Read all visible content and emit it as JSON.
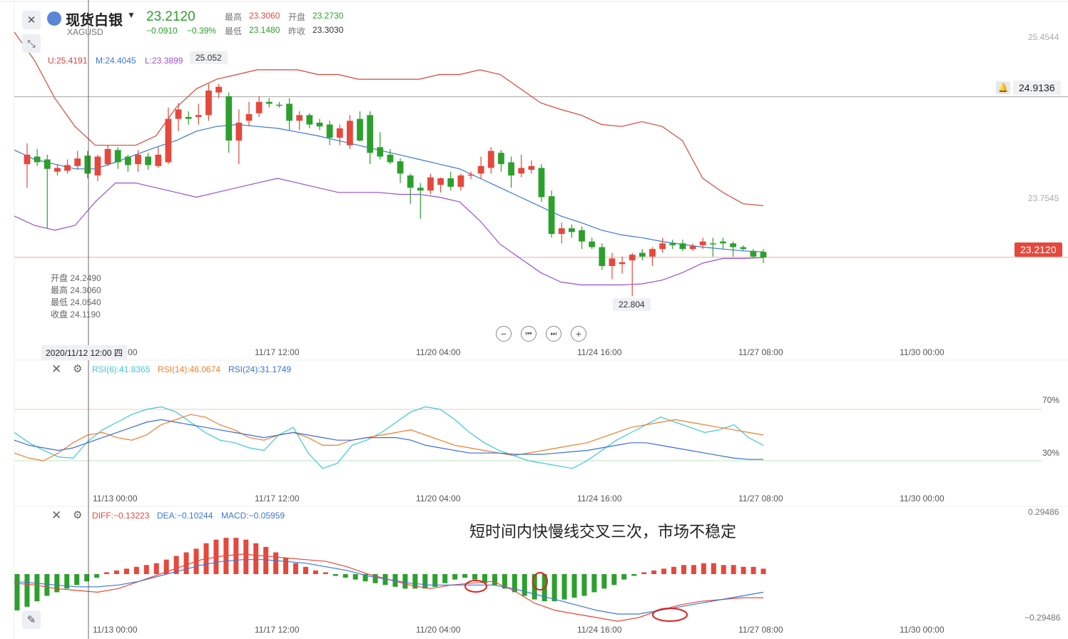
{
  "header": {
    "name": "现货白银",
    "code": "XAGUSD",
    "price": "23.2120",
    "change": "−0.0910",
    "change_pct": "−0.39%",
    "high_label": "最高",
    "high": "23.3060",
    "open_label": "开盘",
    "open": "23.2730",
    "low_label": "最低",
    "low": "23.1480",
    "prev_label": "昨收",
    "prev": "23.3030"
  },
  "boll": {
    "u": "U:25.4191",
    "m": "M:24.4045",
    "l": "L:23.3899"
  },
  "price_axis": {
    "top": "25.4544",
    "mid": "23.7545",
    "line_value": "24.9136",
    "current": "23.2120"
  },
  "callouts": {
    "high": "25.052",
    "low": "22.804"
  },
  "ohlc_tooltip": {
    "open": "开盘 24.2490",
    "high": "最高 24.3060",
    "low": "最低 24.0540",
    "close": "收盘 24.1190"
  },
  "time_axis": {
    "labels": [
      "11/13 00:00",
      "11/17 12:00",
      "11/20 04:00",
      "11/24 16:00",
      "11/27 08:00",
      "11/30 00:00"
    ],
    "crosshair": "2020/11/12 12:00 四"
  },
  "rsi": {
    "rsi6": "RSI(6):41.8365",
    "rsi14": "RSI(14):46.0674",
    "rsi24": "RSI(24):31.1749",
    "level_high": "70%",
    "level_low": "30%"
  },
  "macd": {
    "diff": "DIFF:−0.13223",
    "dea": "DEA:−0.10244",
    "macd": "MACD:−0.05959",
    "axis_top": "0.29486",
    "axis_bottom": "−0.29486",
    "annotation": "短时间内快慢线交叉三次，市场不稳定"
  },
  "colors": {
    "up": "#e5483c",
    "down": "#2ca02c",
    "dea": "#3a78d8",
    "rsi6": "#3cc8d8",
    "rsi14": "#ee7f2d",
    "rsi24": "#3a6ed8",
    "boll_l": "#9b4fd6"
  },
  "chart_data": [
    {
      "type": "candlestick",
      "title": "现货白银 XAGUSD",
      "x_labels": [
        "11/13 00:00",
        "11/17 12:00",
        "11/20 04:00",
        "11/24 16:00",
        "11/27 08:00",
        "11/30 00:00"
      ],
      "ylim": [
        22.5,
        25.6
      ],
      "candles": [
        {
          "o": 24.2,
          "h": 24.42,
          "l": 23.95,
          "c": 24.3
        },
        {
          "o": 24.28,
          "h": 24.36,
          "l": 24.18,
          "c": 24.22
        },
        {
          "o": 24.25,
          "h": 24.3,
          "l": 23.52,
          "c": 24.15
        },
        {
          "o": 24.12,
          "h": 24.2,
          "l": 24.08,
          "c": 24.16
        },
        {
          "o": 24.13,
          "h": 24.25,
          "l": 24.1,
          "c": 24.19
        },
        {
          "o": 24.18,
          "h": 24.34,
          "l": 24.14,
          "c": 24.26
        },
        {
          "o": 24.29,
          "h": 24.34,
          "l": 24.05,
          "c": 24.1
        },
        {
          "o": 24.08,
          "h": 24.3,
          "l": 24.02,
          "c": 24.28
        },
        {
          "o": 24.2,
          "h": 24.4,
          "l": 24.18,
          "c": 24.36
        },
        {
          "o": 24.35,
          "h": 24.38,
          "l": 24.15,
          "c": 24.22
        },
        {
          "o": 24.28,
          "h": 24.3,
          "l": 24.12,
          "c": 24.19
        },
        {
          "o": 24.2,
          "h": 24.35,
          "l": 24.12,
          "c": 24.3
        },
        {
          "o": 24.28,
          "h": 24.32,
          "l": 24.14,
          "c": 24.19
        },
        {
          "o": 24.18,
          "h": 24.38,
          "l": 24.16,
          "c": 24.3
        },
        {
          "o": 24.22,
          "h": 24.8,
          "l": 24.2,
          "c": 24.68
        },
        {
          "o": 24.68,
          "h": 24.85,
          "l": 24.55,
          "c": 24.78
        },
        {
          "o": 24.7,
          "h": 24.76,
          "l": 24.62,
          "c": 24.68
        },
        {
          "o": 24.7,
          "h": 24.84,
          "l": 24.62,
          "c": 24.72
        },
        {
          "o": 24.72,
          "h": 25.05,
          "l": 24.66,
          "c": 24.98
        },
        {
          "o": 24.96,
          "h": 25.05,
          "l": 24.9,
          "c": 25.02
        },
        {
          "o": 24.92,
          "h": 24.96,
          "l": 24.32,
          "c": 24.45
        },
        {
          "o": 24.45,
          "h": 24.78,
          "l": 24.2,
          "c": 24.64
        },
        {
          "o": 24.66,
          "h": 24.86,
          "l": 24.6,
          "c": 24.73
        },
        {
          "o": 24.74,
          "h": 24.92,
          "l": 24.7,
          "c": 24.86
        },
        {
          "o": 24.86,
          "h": 24.9,
          "l": 24.8,
          "c": 24.84
        },
        {
          "o": 24.83,
          "h": 24.86,
          "l": 24.8,
          "c": 24.82
        },
        {
          "o": 24.84,
          "h": 24.9,
          "l": 24.56,
          "c": 24.66
        },
        {
          "o": 24.66,
          "h": 24.76,
          "l": 24.56,
          "c": 24.72
        },
        {
          "o": 24.72,
          "h": 24.74,
          "l": 24.58,
          "c": 24.62
        },
        {
          "o": 24.64,
          "h": 24.68,
          "l": 24.56,
          "c": 24.6
        },
        {
          "o": 24.62,
          "h": 24.66,
          "l": 24.4,
          "c": 24.48
        },
        {
          "o": 24.48,
          "h": 24.62,
          "l": 24.4,
          "c": 24.58
        },
        {
          "o": 24.4,
          "h": 24.72,
          "l": 24.36,
          "c": 24.66
        },
        {
          "o": 24.68,
          "h": 24.76,
          "l": 24.44,
          "c": 24.45
        },
        {
          "o": 24.72,
          "h": 24.76,
          "l": 24.2,
          "c": 24.32
        },
        {
          "o": 24.38,
          "h": 24.54,
          "l": 24.25,
          "c": 24.28
        },
        {
          "o": 24.3,
          "h": 24.36,
          "l": 24.2,
          "c": 24.22
        },
        {
          "o": 24.23,
          "h": 24.26,
          "l": 24.0,
          "c": 24.1
        },
        {
          "o": 24.08,
          "h": 24.1,
          "l": 23.78,
          "c": 23.95
        },
        {
          "o": 23.95,
          "h": 24.0,
          "l": 23.62,
          "c": 23.92
        },
        {
          "o": 23.92,
          "h": 24.1,
          "l": 23.88,
          "c": 24.06
        },
        {
          "o": 23.98,
          "h": 24.06,
          "l": 23.9,
          "c": 24.05
        },
        {
          "o": 24.05,
          "h": 24.12,
          "l": 23.92,
          "c": 23.96
        },
        {
          "o": 23.96,
          "h": 24.1,
          "l": 23.92,
          "c": 24.08
        },
        {
          "o": 24.08,
          "h": 24.12,
          "l": 24.04,
          "c": 24.09
        },
        {
          "o": 24.1,
          "h": 24.28,
          "l": 24.05,
          "c": 24.18
        },
        {
          "o": 24.16,
          "h": 24.38,
          "l": 24.1,
          "c": 24.34
        },
        {
          "o": 24.32,
          "h": 24.35,
          "l": 24.12,
          "c": 24.2
        },
        {
          "o": 24.22,
          "h": 24.28,
          "l": 23.95,
          "c": 24.08
        },
        {
          "o": 24.1,
          "h": 24.3,
          "l": 24.06,
          "c": 24.16
        },
        {
          "o": 24.14,
          "h": 24.24,
          "l": 24.1,
          "c": 24.18
        },
        {
          "o": 24.16,
          "h": 24.2,
          "l": 23.8,
          "c": 23.85
        },
        {
          "o": 23.86,
          "h": 23.92,
          "l": 23.42,
          "c": 23.46
        },
        {
          "o": 23.46,
          "h": 23.58,
          "l": 23.36,
          "c": 23.52
        },
        {
          "o": 23.52,
          "h": 23.56,
          "l": 23.42,
          "c": 23.48
        },
        {
          "o": 23.5,
          "h": 23.54,
          "l": 23.3,
          "c": 23.38
        },
        {
          "o": 23.38,
          "h": 23.42,
          "l": 23.3,
          "c": 23.32
        },
        {
          "o": 23.32,
          "h": 23.36,
          "l": 23.08,
          "c": 23.12
        },
        {
          "o": 23.12,
          "h": 23.26,
          "l": 22.98,
          "c": 23.2
        },
        {
          "o": 23.14,
          "h": 23.22,
          "l": 23.04,
          "c": 23.16
        },
        {
          "o": 23.18,
          "h": 23.26,
          "l": 22.8,
          "c": 23.24
        },
        {
          "o": 23.26,
          "h": 23.3,
          "l": 23.18,
          "c": 23.22
        },
        {
          "o": 23.22,
          "h": 23.32,
          "l": 23.12,
          "c": 23.3
        },
        {
          "o": 23.3,
          "h": 23.42,
          "l": 23.26,
          "c": 23.36
        },
        {
          "o": 23.36,
          "h": 23.4,
          "l": 23.3,
          "c": 23.34
        },
        {
          "o": 23.36,
          "h": 23.4,
          "l": 23.28,
          "c": 23.3
        },
        {
          "o": 23.3,
          "h": 23.36,
          "l": 23.28,
          "c": 23.33
        },
        {
          "o": 23.34,
          "h": 23.42,
          "l": 23.3,
          "c": 23.38
        },
        {
          "o": 23.36,
          "h": 23.42,
          "l": 23.22,
          "c": 23.35
        },
        {
          "o": 23.38,
          "h": 23.42,
          "l": 23.3,
          "c": 23.36
        },
        {
          "o": 23.36,
          "h": 23.38,
          "l": 23.22,
          "c": 23.32
        },
        {
          "o": 23.32,
          "h": 23.34,
          "l": 23.28,
          "c": 23.3
        },
        {
          "o": 23.28,
          "h": 23.3,
          "l": 23.2,
          "c": 23.22
        },
        {
          "o": 23.27,
          "h": 23.3,
          "l": 23.15,
          "c": 23.21
        }
      ],
      "boll_upper": [
        25.6,
        25.3,
        24.9,
        24.6,
        24.4,
        24.4,
        24.4,
        24.5,
        24.8,
        25.0,
        25.1,
        25.15,
        25.2,
        25.2,
        25.2,
        25.15,
        25.15,
        25.1,
        25.1,
        25.1,
        25.1,
        25.15,
        25.15,
        25.2,
        25.15,
        25.0,
        24.85,
        24.78,
        24.72,
        24.62,
        24.6,
        24.65,
        24.6,
        24.45,
        24.05,
        23.9,
        23.78,
        23.76
      ],
      "boll_mid": [
        24.35,
        24.25,
        24.2,
        24.15,
        24.15,
        24.22,
        24.3,
        24.38,
        24.45,
        24.55,
        24.6,
        24.62,
        24.6,
        24.58,
        24.54,
        24.5,
        24.45,
        24.4,
        24.35,
        24.3,
        24.25,
        24.2,
        24.15,
        24.05,
        23.95,
        23.85,
        23.75,
        23.65,
        23.58,
        23.5,
        23.45,
        23.42,
        23.38,
        23.35,
        23.32,
        23.3,
        23.28,
        23.27
      ],
      "boll_lower": [
        23.65,
        23.55,
        23.5,
        23.55,
        23.8,
        24.0,
        24.0,
        23.95,
        23.9,
        23.85,
        23.9,
        23.95,
        24.0,
        24.05,
        24.0,
        23.95,
        23.9,
        23.9,
        23.9,
        23.88,
        23.88,
        23.85,
        23.8,
        23.6,
        23.35,
        23.2,
        23.05,
        22.95,
        22.92,
        22.92,
        22.92,
        22.93,
        22.97,
        23.05,
        23.15,
        23.2,
        23.2,
        23.21
      ],
      "reference_line": 24.9136,
      "current": 23.212
    },
    {
      "type": "line",
      "title": "RSI",
      "ylim": [
        0,
        100
      ],
      "levels": [
        70,
        30
      ],
      "series": [
        {
          "name": "RSI(6)",
          "values": [
            52,
            44,
            38,
            33,
            32,
            45,
            54,
            60,
            66,
            70,
            72,
            68,
            60,
            52,
            46,
            44,
            40,
            38,
            50,
            56,
            36,
            24,
            28,
            42,
            46,
            52,
            60,
            68,
            72,
            70,
            62,
            52,
            44,
            38,
            34,
            30,
            28,
            26,
            24,
            30,
            38,
            46,
            52,
            58,
            64,
            60,
            56,
            52,
            54,
            58,
            48,
            42
          ]
        },
        {
          "name": "RSI(14)",
          "values": [
            36,
            32,
            30,
            36,
            44,
            50,
            52,
            48,
            46,
            50,
            58,
            62,
            66,
            64,
            58,
            54,
            48,
            46,
            50,
            52,
            48,
            42,
            42,
            46,
            48,
            50,
            52,
            54,
            50,
            46,
            42,
            40,
            38,
            36,
            34,
            36,
            38,
            40,
            42,
            44,
            48,
            52,
            56,
            58,
            60,
            62,
            60,
            58,
            56,
            54,
            52,
            50
          ]
        },
        {
          "name": "RSI(24)",
          "values": [
            46,
            42,
            40,
            38,
            40,
            44,
            48,
            52,
            56,
            60,
            62,
            60,
            58,
            56,
            54,
            52,
            50,
            48,
            50,
            52,
            50,
            48,
            46,
            46,
            48,
            48,
            48,
            46,
            42,
            40,
            38,
            36,
            36,
            36,
            35,
            35,
            35,
            36,
            37,
            38,
            40,
            42,
            44,
            44,
            42,
            40,
            38,
            36,
            34,
            32,
            31,
            31
          ]
        }
      ]
    },
    {
      "type": "bar",
      "title": "MACD",
      "ylim": [
        -0.29486,
        0.29486
      ],
      "values": [
        -0.2,
        -0.18,
        -0.15,
        -0.12,
        -0.1,
        -0.08,
        -0.06,
        -0.04,
        -0.02,
        0.01,
        0.02,
        0.03,
        0.04,
        0.05,
        0.06,
        0.08,
        0.1,
        0.12,
        0.14,
        0.17,
        0.19,
        0.2,
        0.2,
        0.19,
        0.17,
        0.15,
        0.12,
        0.09,
        0.06,
        0.04,
        0.02,
        0.01,
        -0.01,
        -0.02,
        -0.03,
        -0.04,
        -0.05,
        -0.06,
        -0.07,
        -0.08,
        -0.08,
        -0.08,
        -0.07,
        -0.05,
        -0.03,
        -0.02,
        -0.03,
        -0.05,
        -0.06,
        -0.08,
        -0.1,
        -0.12,
        -0.14,
        -0.15,
        -0.15,
        -0.14,
        -0.13,
        -0.12,
        -0.1,
        -0.08,
        -0.06,
        -0.03,
        -0.01,
        0.01,
        0.02,
        0.03,
        0.04,
        0.05,
        0.05,
        0.06,
        0.06,
        0.05,
        0.05,
        0.04,
        0.04,
        0.03
      ],
      "series": [
        {
          "name": "DIFF",
          "values": [
            -0.05,
            -0.06,
            -0.08,
            -0.09,
            -0.1,
            -0.08,
            -0.04,
            0.0,
            0.04,
            0.08,
            0.1,
            0.11,
            0.1,
            0.09,
            0.08,
            0.07,
            0.04,
            0.0,
            -0.03,
            -0.06,
            -0.08,
            -0.06,
            -0.05,
            -0.04,
            -0.09,
            -0.16,
            -0.2,
            -0.22,
            -0.24,
            -0.26,
            -0.24,
            -0.2,
            -0.17,
            -0.15,
            -0.14,
            -0.13,
            -0.13
          ]
        },
        {
          "name": "DEA",
          "values": [
            -0.04,
            -0.05,
            -0.06,
            -0.07,
            -0.07,
            -0.06,
            -0.04,
            -0.01,
            0.02,
            0.05,
            0.07,
            0.08,
            0.08,
            0.07,
            0.06,
            0.04,
            0.02,
            -0.01,
            -0.03,
            -0.05,
            -0.06,
            -0.06,
            -0.06,
            -0.06,
            -0.08,
            -0.11,
            -0.14,
            -0.17,
            -0.2,
            -0.22,
            -0.22,
            -0.2,
            -0.18,
            -0.16,
            -0.14,
            -0.12,
            -0.1
          ]
        }
      ],
      "annotations": [
        "短时间内快慢线交叉三次，市场不稳定"
      ]
    }
  ]
}
